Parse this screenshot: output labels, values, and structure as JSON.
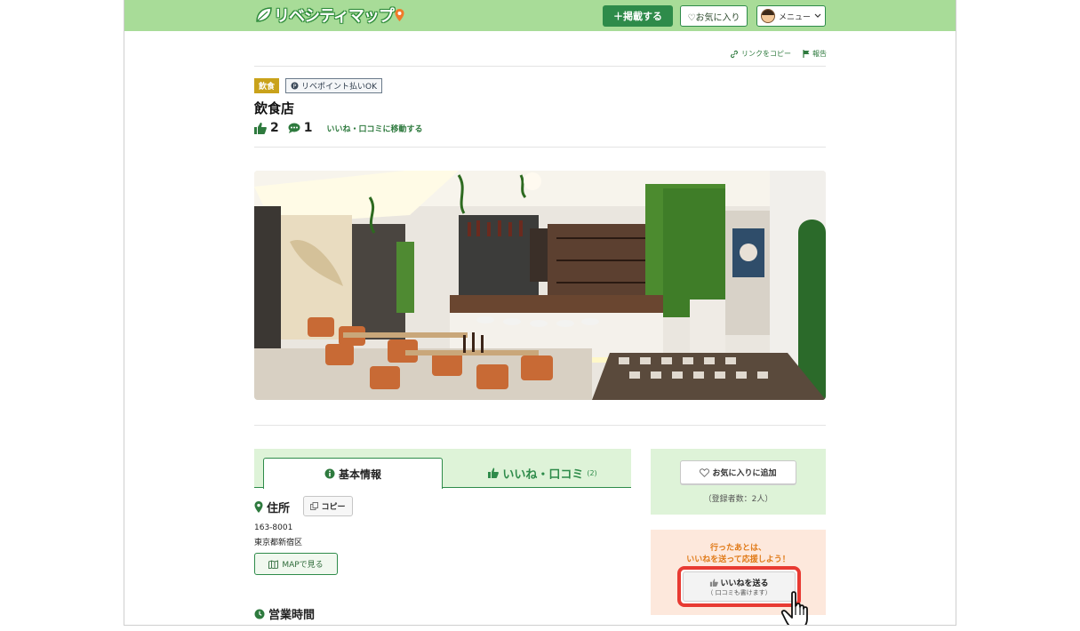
{
  "header": {
    "logo_text": "リベシティマップ",
    "post_button": "＋掲載する",
    "favorites_button": "♡お気に入り",
    "menu_button": "メニュー"
  },
  "utility": {
    "copy_link": "リンクをコピー",
    "report": "報告"
  },
  "listing": {
    "category_tag": "飲食",
    "payment_tag": "リベポイント払いOK",
    "title": "飲食店",
    "likes": "2",
    "comments": "1",
    "jump_link": "いいね・口コミに移動する"
  },
  "tabs": [
    {
      "label": "基本情報"
    },
    {
      "label": "いいね・口コミ",
      "count": "(2)"
    }
  ],
  "info": {
    "address_heading": "住所",
    "copy_button": "コピー",
    "postal_code": "163-8001",
    "address": "東京都新宿区",
    "map_button": "MAPで見る",
    "hours_heading": "営業時間"
  },
  "sidebar": {
    "add_favorite": "お気に入りに追加",
    "favorite_count": "（登録者数：2人）",
    "like_prompt_line1": "行ったあとは、",
    "like_prompt_line2": "いいねを送って応援しよう！",
    "like_button": "いいねを送る",
    "like_button_sub": "（ 口コミも書けます）"
  },
  "colors": {
    "header_bg": "#a8dc98",
    "brand_green": "#2e8b4a",
    "tab_band": "#def3d8",
    "like_panel": "#fde8dc",
    "highlight_red": "#e83a32",
    "category_gold": "#c9a21a"
  }
}
